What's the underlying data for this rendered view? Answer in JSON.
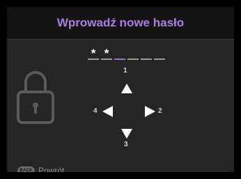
{
  "dialog": {
    "title": "Wprowadź nowe hasło"
  },
  "password": {
    "slots": [
      "*",
      "*",
      "",
      "",
      "",
      ""
    ],
    "active_slot": 2
  },
  "keypad": {
    "up": {
      "number": "1",
      "arrow": "up-arrow-icon"
    },
    "left": {
      "number": "4",
      "arrow": "left-arrow-icon"
    },
    "right": {
      "number": "2",
      "arrow": "right-arrow-icon"
    },
    "down": {
      "number": "3",
      "arrow": "down-arrow-icon"
    }
  },
  "footer": {
    "back_badge": "BACK",
    "back_label": "Powrót"
  },
  "colors": {
    "title": "#b17be8",
    "background": "#252525",
    "title_bar": "#141414",
    "active_slot": "#9a6fd0"
  }
}
